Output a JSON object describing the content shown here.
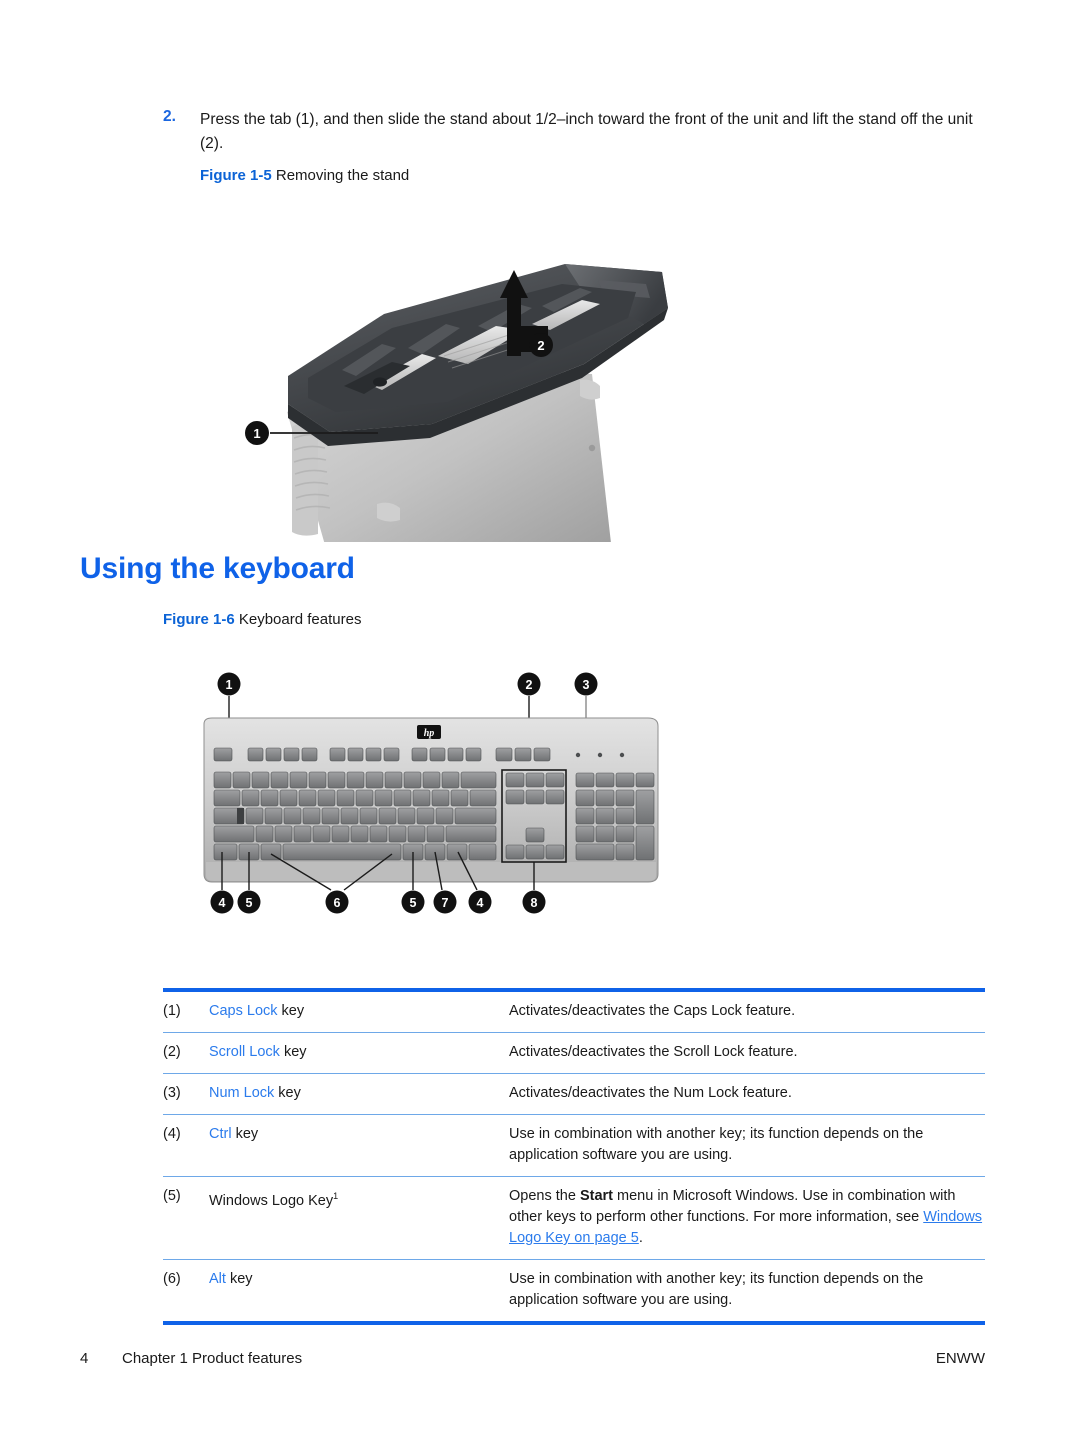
{
  "step": {
    "number": "2.",
    "text": "Press the tab (1), and then slide the stand about 1/2–inch toward the front of the unit and lift the stand off the unit (2)."
  },
  "figures": [
    {
      "label": "Figure 1-5",
      "title": "Removing the stand",
      "callouts": [
        "1",
        "2"
      ]
    },
    {
      "label": "Figure 1-6",
      "title": "Keyboard features",
      "callouts": [
        "1",
        "2",
        "3",
        "4",
        "5",
        "6",
        "7",
        "8"
      ]
    }
  ],
  "heading": "Using the keyboard",
  "table": {
    "rows": [
      {
        "num": "(1)",
        "key_link": "Caps Lock",
        "key_rest": " key",
        "desc": "Activates/deactivates the Caps Lock feature."
      },
      {
        "num": "(2)",
        "key_link": "Scroll Lock",
        "key_rest": " key",
        "desc": "Activates/deactivates the Scroll Lock feature."
      },
      {
        "num": "(3)",
        "key_link": "Num Lock",
        "key_rest": " key",
        "desc": "Activates/deactivates the Num Lock feature."
      },
      {
        "num": "(4)",
        "key_link": "Ctrl",
        "key_rest": " key",
        "desc": "Use in combination with another key; its function depends on the application software you are using."
      },
      {
        "num": "(5)",
        "key_plain": "Windows Logo Key",
        "key_sup": "1",
        "desc_part1": "Opens the ",
        "desc_bold": "Start",
        "desc_part2": " menu in Microsoft Windows. Use in combination with other keys to perform other functions. For more information, see ",
        "desc_xref": "Windows Logo Key on page 5",
        "desc_part3": "."
      },
      {
        "num": "(6)",
        "key_link": "Alt",
        "key_rest": " key",
        "desc": "Use in combination with another key; its function depends on the application software you are using."
      }
    ]
  },
  "footer": {
    "page": "4",
    "chapter": "Chapter 1   Product features",
    "locale": "ENWW"
  },
  "colors": {
    "accent_blue": "#0f62e8",
    "link_blue": "#2b7bec",
    "rule_blue": "#6ea8e8"
  }
}
